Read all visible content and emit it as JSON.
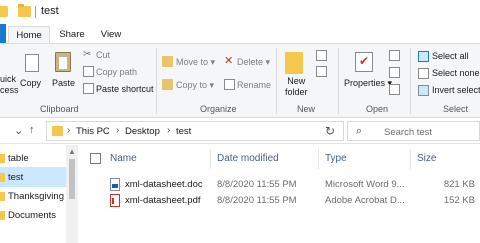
{
  "window": {
    "title": "test"
  },
  "ribbon_tabs": [
    "Home",
    "Share",
    "View"
  ],
  "ribbon": {
    "clipboard": {
      "quick_access_partial": "uick\ncess",
      "copy": "Copy",
      "paste": "Paste",
      "cut": "Cut",
      "copy_path": "Copy path",
      "paste_shortcut": "Paste shortcut",
      "label": "Clipboard"
    },
    "organize": {
      "move_to": "Move to",
      "copy_to": "Copy to",
      "delete": "Delete",
      "rename": "Rename",
      "label": "Organize"
    },
    "new": {
      "new_folder": "New\nfolder",
      "label": "New"
    },
    "open": {
      "properties": "Properties",
      "label": "Open"
    },
    "select": {
      "select_all": "Select all",
      "select_none": "Select none",
      "invert_selection": "Invert selectio",
      "label": "Select"
    }
  },
  "address": {
    "crumbs": [
      "This PC",
      "Desktop",
      "test"
    ],
    "search_placeholder": "Search test"
  },
  "nav_pane": {
    "items": [
      "table",
      "test",
      "Thanksgiving",
      "Documents"
    ],
    "selected_index": 1
  },
  "file_list": {
    "columns": [
      "Name",
      "Date modified",
      "Type",
      "Size"
    ],
    "rows": [
      {
        "icon": "word-doc-icon",
        "name": "xml-datasheet.doc",
        "modified": "8/8/2020 11:55 PM",
        "type": "Microsoft Word 9...",
        "size": "821 KB"
      },
      {
        "icon": "pdf-icon",
        "name": "xml-datasheet.pdf",
        "modified": "8/8/2020 11:55 PM",
        "type": "Adobe Acrobat D...",
        "size": "152 KB"
      }
    ]
  },
  "colors": {
    "accent": "#1979ca",
    "selection": "#cce8ff",
    "folder": "#f5c74a"
  }
}
